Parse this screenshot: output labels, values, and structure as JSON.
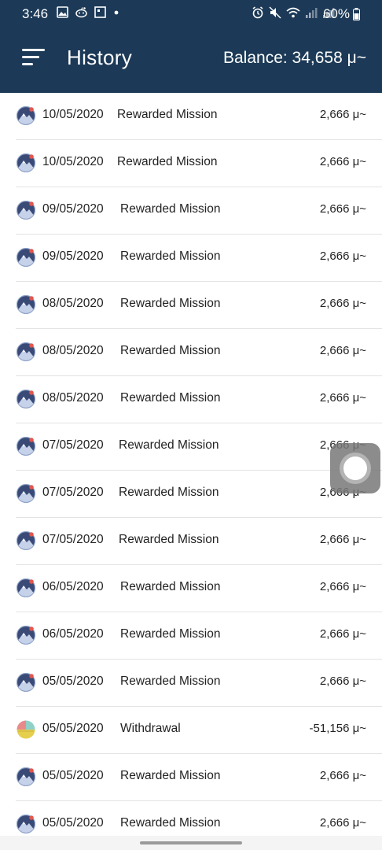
{
  "status_bar": {
    "time": "3:46",
    "battery_percent": "60%",
    "left_icons": [
      "image-icon",
      "reddit-icon",
      "square-icon",
      "dot-icon"
    ],
    "right_icons": [
      "alarm-icon",
      "mute-icon",
      "wifi-icon",
      "signal-icon",
      "signal-icon"
    ]
  },
  "appbar": {
    "title": "History",
    "balance": "Balance: 34,658 μ~"
  },
  "colors": {
    "header": "#1c3a57",
    "row_divider": "#e3e3e3",
    "text": "#222222"
  },
  "rows": [
    {
      "date": "10/05/2020",
      "description": "Rewarded Mission",
      "amount": "2,666 μ~",
      "icon": "mission-icon"
    },
    {
      "date": "10/05/2020",
      "description": "Rewarded Mission",
      "amount": "2,666 μ~",
      "icon": "mission-icon"
    },
    {
      "date": "09/05/2020",
      "description": "Rewarded Mission",
      "amount": "2,666 μ~",
      "icon": "mission-icon"
    },
    {
      "date": "09/05/2020",
      "description": "Rewarded Mission",
      "amount": "2,666 μ~",
      "icon": "mission-icon"
    },
    {
      "date": "08/05/2020",
      "description": "Rewarded Mission",
      "amount": "2,666 μ~",
      "icon": "mission-icon"
    },
    {
      "date": "08/05/2020",
      "description": "Rewarded Mission",
      "amount": "2,666 μ~",
      "icon": "mission-icon"
    },
    {
      "date": "08/05/2020",
      "description": "Rewarded Mission",
      "amount": "2,666 μ~",
      "icon": "mission-icon"
    },
    {
      "date": "07/05/2020",
      "description": "Rewarded Mission",
      "amount": "2,666 μ~",
      "icon": "mission-icon"
    },
    {
      "date": "07/05/2020",
      "description": "Rewarded Mission",
      "amount": "2,666 μ~",
      "icon": "mission-icon"
    },
    {
      "date": "07/05/2020",
      "description": "Rewarded Mission",
      "amount": "2,666 μ~",
      "icon": "mission-icon"
    },
    {
      "date": "06/05/2020",
      "description": "Rewarded Mission",
      "amount": "2,666 μ~",
      "icon": "mission-icon"
    },
    {
      "date": "06/05/2020",
      "description": "Rewarded Mission",
      "amount": "2,666 μ~",
      "icon": "mission-icon"
    },
    {
      "date": "05/05/2020",
      "description": "Rewarded Mission",
      "amount": "2,666 μ~",
      "icon": "mission-icon"
    },
    {
      "date": "05/05/2020",
      "description": "Withdrawal",
      "amount": "-51,156 μ~",
      "icon": "withdrawal-icon"
    },
    {
      "date": "05/05/2020",
      "description": "Rewarded Mission",
      "amount": "2,666 μ~",
      "icon": "mission-icon"
    },
    {
      "date": "05/05/2020",
      "description": "Rewarded Mission",
      "amount": "2,666 μ~",
      "icon": "mission-icon"
    }
  ]
}
